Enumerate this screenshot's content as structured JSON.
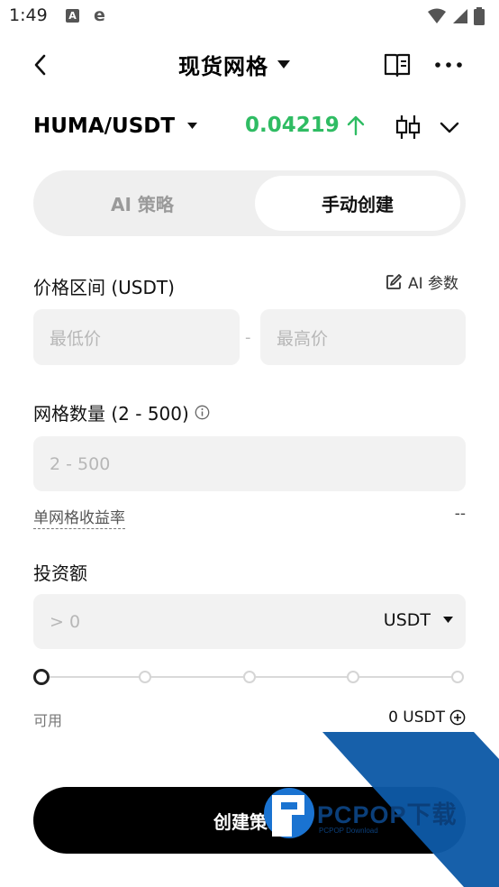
{
  "status_bar": {
    "time": "1:49",
    "badge_a": "A",
    "badge_e": "e"
  },
  "nav": {
    "title": "现货网格",
    "back_icon": "chevron-left-icon",
    "book_icon": "book-icon",
    "more_icon": "more-horizontal-icon"
  },
  "pair": {
    "name": "HUMA/USDT",
    "price": "0.04219",
    "price_color": "#2fbc63",
    "trend": "up",
    "chart_icon": "candlestick-icon",
    "expand_icon": "chevron-down-icon"
  },
  "tabs": {
    "ai": "AI 策略",
    "manual": "手动创建",
    "active": "manual"
  },
  "price_range": {
    "label": "价格区间 (USDT)",
    "ai_params": "AI 参数",
    "min_placeholder": "最低价",
    "separator": "-",
    "max_placeholder": "最高价"
  },
  "grid_count": {
    "label": "网格数量 (2 - 500)",
    "placeholder": "2 - 500",
    "yield_label": "单网格收益率",
    "yield_value": "--"
  },
  "investment": {
    "label": "投资额",
    "placeholder": "> 0",
    "currency": "USDT",
    "slider_value": 0,
    "slider_steps": 5,
    "available_label": "可用",
    "available_value": "0 USDT"
  },
  "submit": {
    "label": "创建策略"
  },
  "watermark": {
    "brand": "PCPOP下载",
    "sub": "PCPOP Download"
  }
}
